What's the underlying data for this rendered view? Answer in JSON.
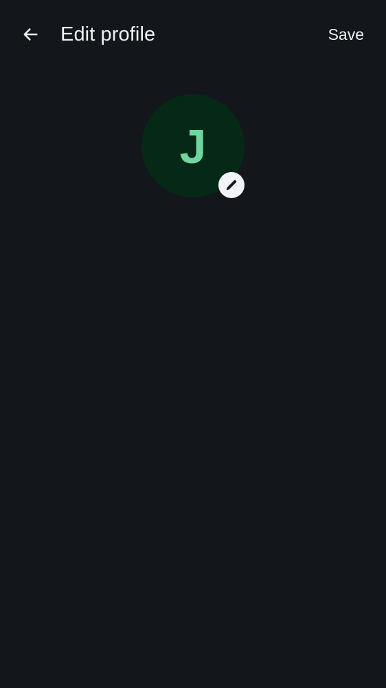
{
  "header": {
    "back_icon": "arrow-left-icon",
    "title": "Edit profile",
    "save_label": "Save"
  },
  "profile": {
    "avatar_initial": "J",
    "edit_icon": "pencil-icon"
  },
  "colors": {
    "background": "#13161b",
    "text": "#eef0f3",
    "avatar_background": "#062817",
    "avatar_initial": "#6fd6a0",
    "edit_badge_background": "#f2f4f7",
    "edit_icon": "#13161b"
  }
}
